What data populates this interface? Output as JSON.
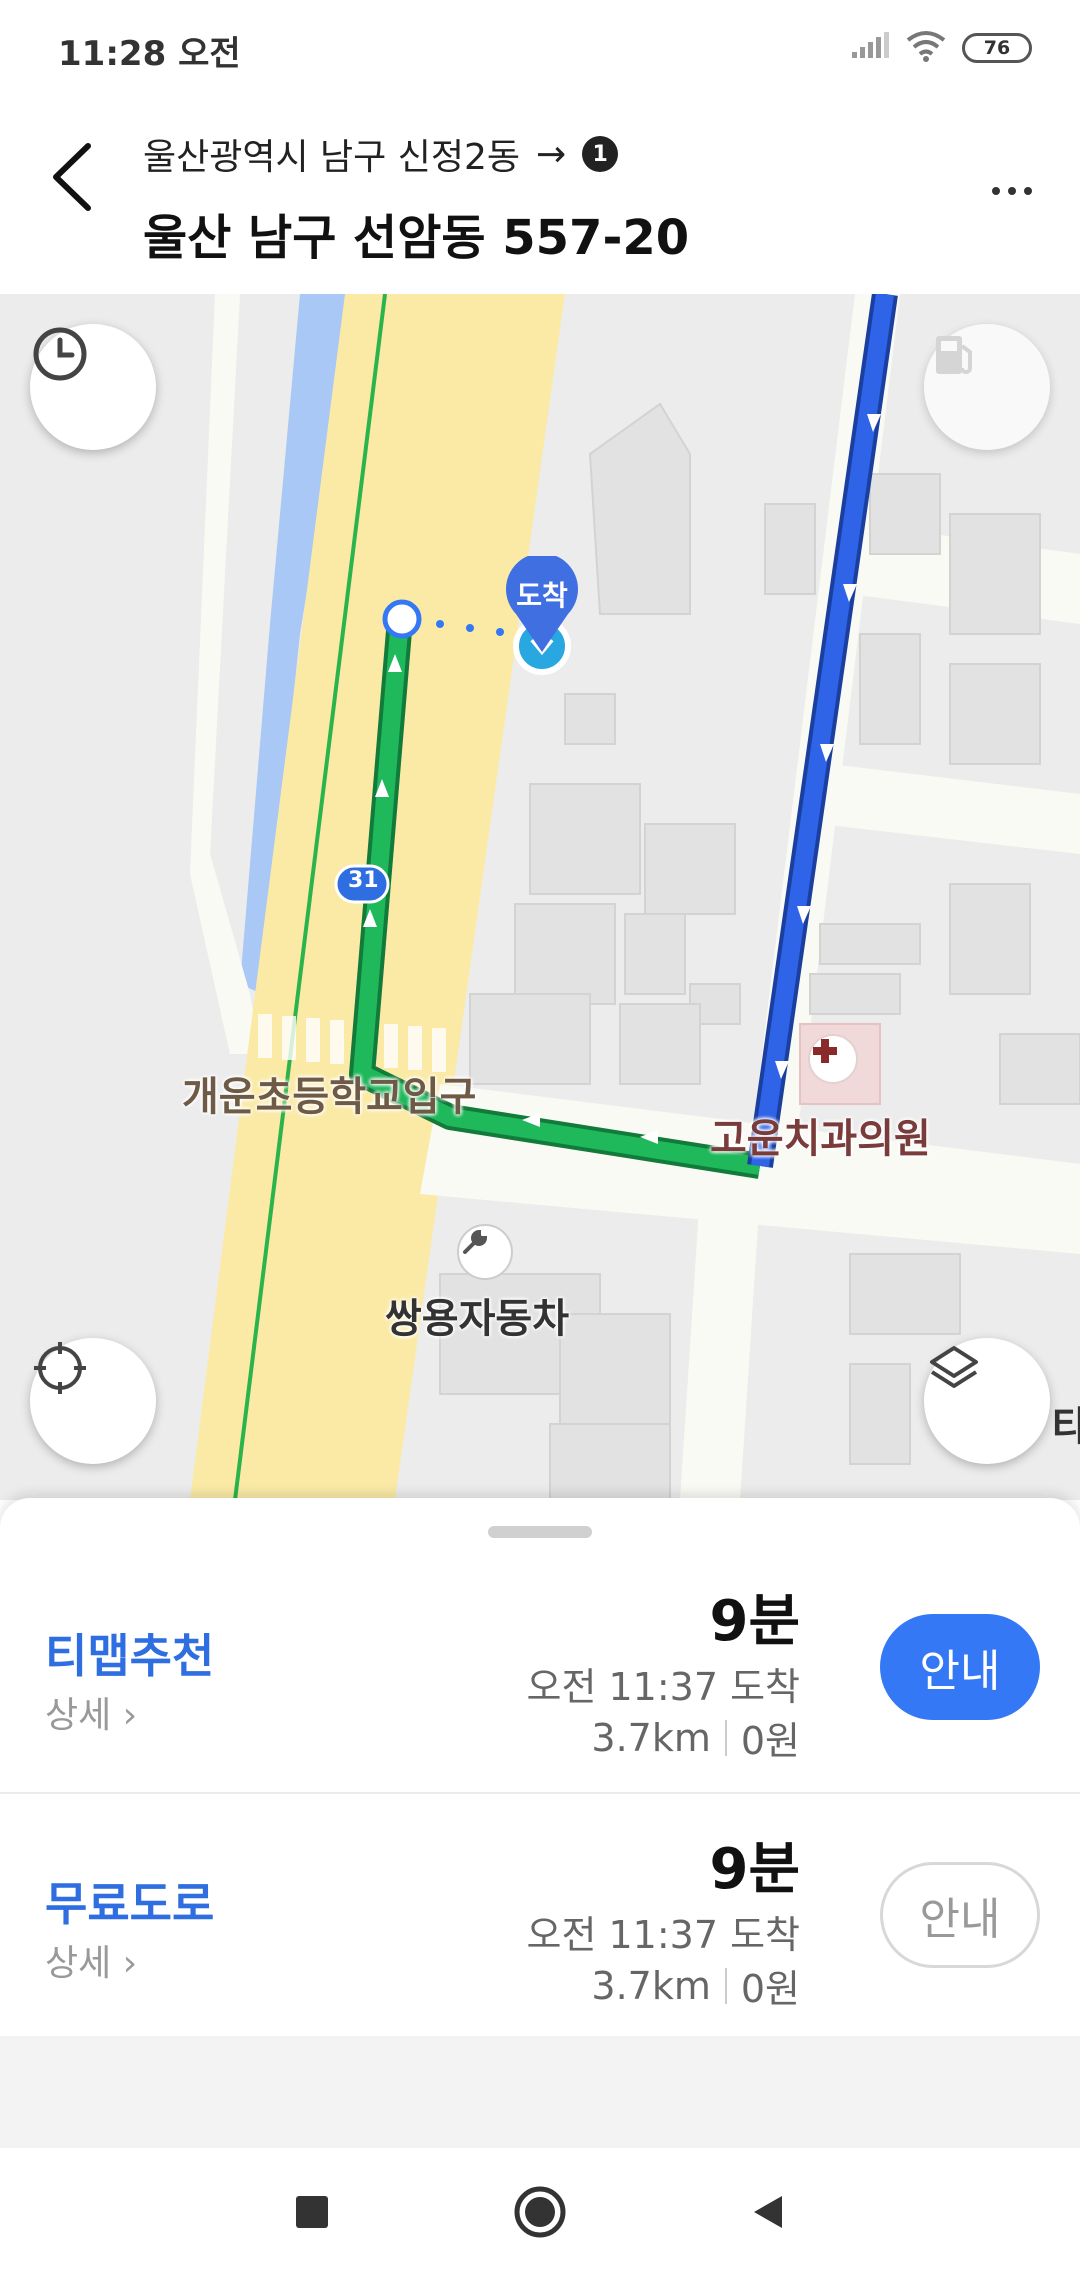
{
  "status": {
    "time": "11:28 오전",
    "battery": "76",
    "icons": [
      "signal-icon",
      "wifi-icon",
      "battery-icon"
    ]
  },
  "header": {
    "from": "울산광역시 남구 신정2동",
    "arrow": "→",
    "step": "1",
    "destination": "울산 남구 선암동 557-20"
  },
  "map": {
    "arrive_label": "도착",
    "road_number": "31",
    "labels": {
      "school_entrance": "개운초등학교입구",
      "dental": "고운치과의원",
      "ssangyong": "쌍용자동차",
      "partial": "타"
    },
    "colors": {
      "route_green": "#1fb85a",
      "route_blue": "#2f63e8",
      "main_road": "#fbeaa6",
      "water": "#a9c8f5"
    }
  },
  "routes": [
    {
      "name": "티맵추천",
      "detail": "상세",
      "duration": "9분",
      "arrival": "오전 11:37 도착",
      "distance": "3.7km",
      "cost": "0원",
      "button": "안내",
      "selected": true
    },
    {
      "name": "무료도로",
      "detail": "상세",
      "duration": "9분",
      "arrival": "오전 11:37 도착",
      "distance": "3.7km",
      "cost": "0원",
      "button": "안내",
      "selected": false
    }
  ]
}
